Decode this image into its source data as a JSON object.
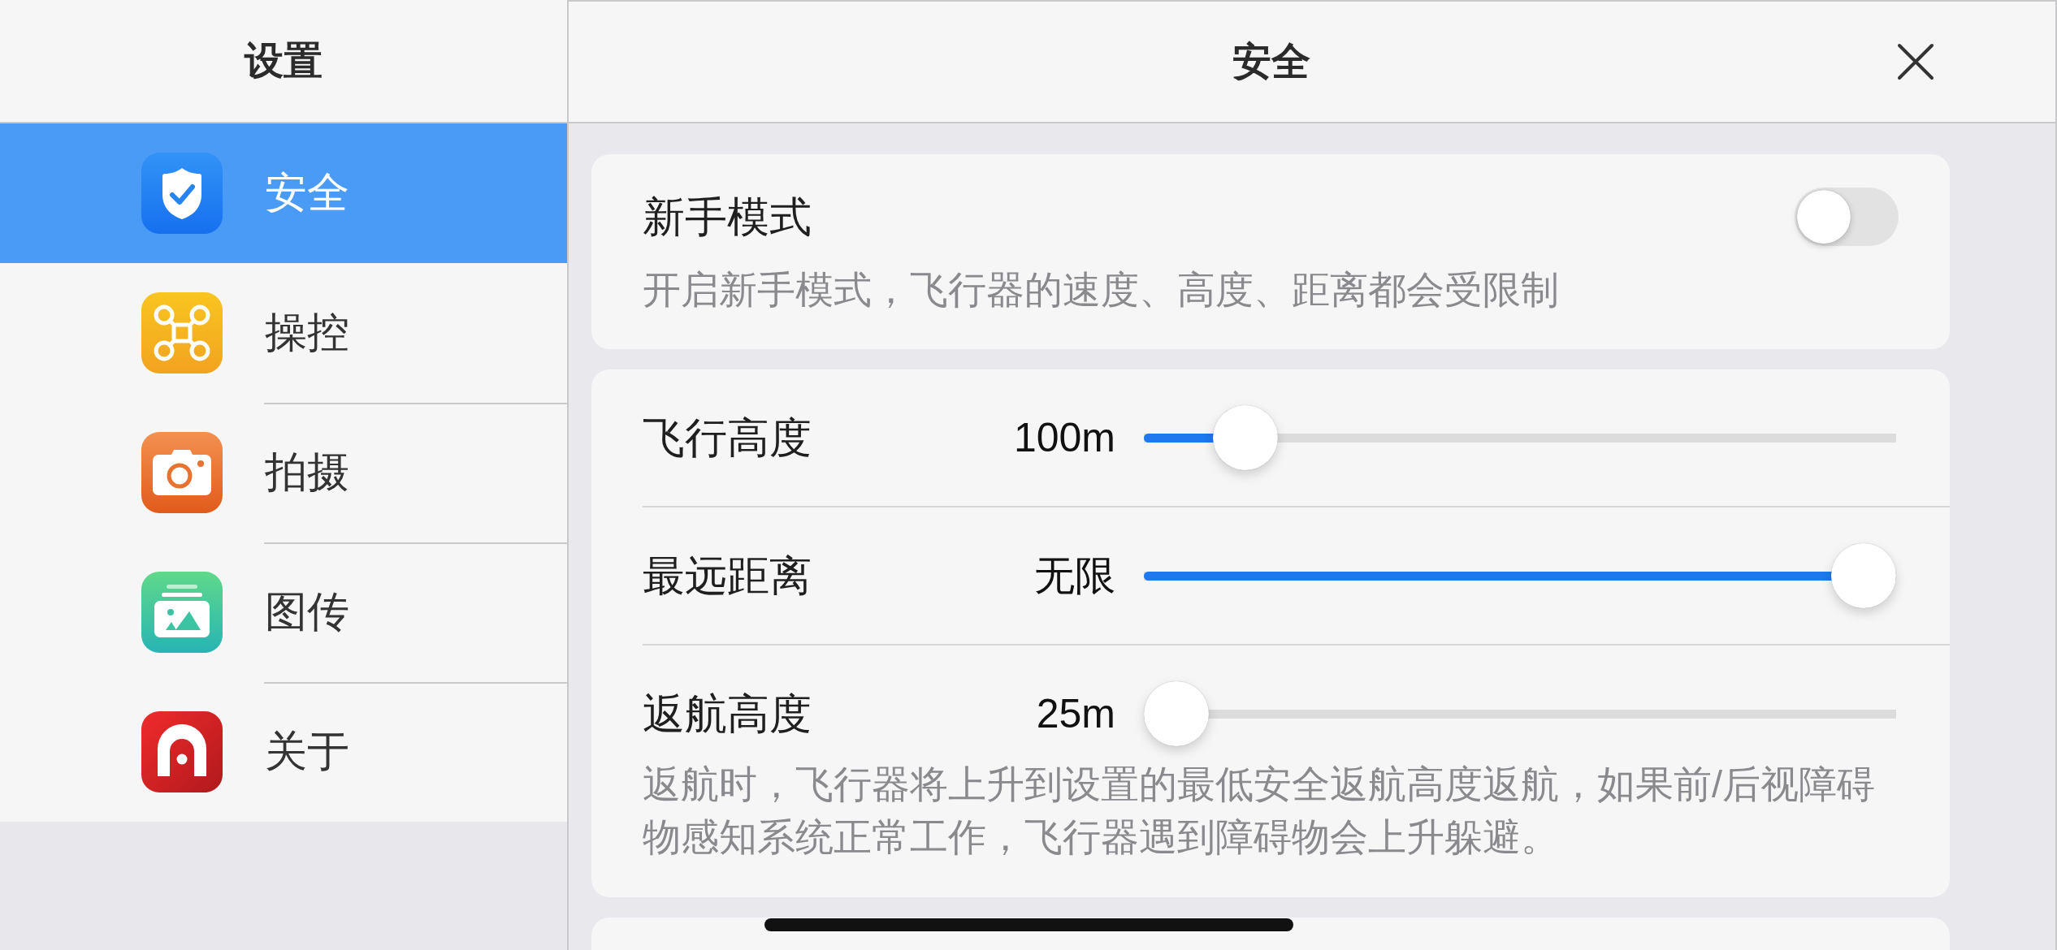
{
  "sidebar": {
    "title": "设置",
    "items": [
      {
        "label": "安全",
        "selected": true
      },
      {
        "label": "操控",
        "selected": false
      },
      {
        "label": "拍摄",
        "selected": false
      },
      {
        "label": "图传",
        "selected": false
      },
      {
        "label": "关于",
        "selected": false
      }
    ]
  },
  "panel": {
    "title": "安全"
  },
  "cards": [
    {
      "rows": [
        {
          "kind": "toggle",
          "label": "新手模式",
          "on": false,
          "description": "开启新手模式，飞行器的速度、高度、距离都会受限制"
        }
      ]
    },
    {
      "rows": [
        {
          "kind": "slider",
          "label": "飞行高度",
          "value": "100m",
          "level": 0.1
        },
        {
          "kind": "slider",
          "label": "最远距离",
          "value": "无限",
          "level": 1
        },
        {
          "kind": "slider",
          "label": "返航高度",
          "value": "25m",
          "level": 0
        }
      ],
      "note": "返航时，飞行器将上升到设置的最低安全返航高度返航，如果前/后视障碍物感知系统正常工作，飞行器遇到障碍物会上升躲避。"
    }
  ]
}
